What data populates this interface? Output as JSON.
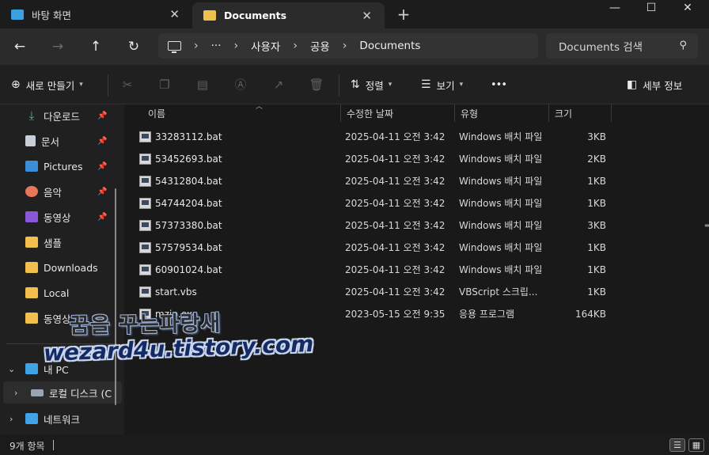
{
  "tabs": [
    {
      "label": "바탕 화면",
      "active": false,
      "icon": "desktop-folder-icon"
    },
    {
      "label": "Documents",
      "active": true,
      "icon": "folder-icon"
    }
  ],
  "window_controls": {
    "minimize": "—",
    "maximize": "☐",
    "close": "✕"
  },
  "nav": {
    "back": "back-arrow-icon",
    "forward": "forward-arrow-icon",
    "up": "up-arrow-icon",
    "refresh": "refresh-icon"
  },
  "address": {
    "segments": [
      "···",
      "사용자",
      "공용",
      "Documents"
    ]
  },
  "search": {
    "placeholder": "Documents 검색"
  },
  "commandbar": {
    "new_label": "새로 만들기",
    "sort_label": "정렬",
    "view_label": "보기",
    "more": "•••",
    "details_label": "세부 정보"
  },
  "sidebar": {
    "quick_access": [
      {
        "label": "다운로드",
        "icon": "download-icon",
        "pinned": true
      },
      {
        "label": "문서",
        "icon": "documents-icon",
        "pinned": true
      },
      {
        "label": "Pictures",
        "icon": "pictures-icon",
        "pinned": true
      },
      {
        "label": "음악",
        "icon": "music-icon",
        "pinned": true
      },
      {
        "label": "동영상",
        "icon": "video-icon",
        "pinned": true
      },
      {
        "label": "샘플",
        "icon": "folder-icon",
        "pinned": false
      },
      {
        "label": "Downloads",
        "icon": "folder-icon",
        "pinned": false
      },
      {
        "label": "Local",
        "icon": "folder-icon",
        "pinned": false
      },
      {
        "label": "동영상",
        "icon": "folder-icon",
        "pinned": false
      }
    ],
    "this_pc": "내 PC",
    "local_disk": "로컬 디스크 (C",
    "network": "네트워크"
  },
  "columns": {
    "name": "이름",
    "date": "수정한 날짜",
    "type": "유형",
    "size": "크기"
  },
  "files": [
    {
      "name": "33283112.bat",
      "date": "2025-04-11 오전 3:42",
      "type": "Windows 배치 파일",
      "size": "3KB"
    },
    {
      "name": "53452693.bat",
      "date": "2025-04-11 오전 3:42",
      "type": "Windows 배치 파일",
      "size": "2KB"
    },
    {
      "name": "54312804.bat",
      "date": "2025-04-11 오전 3:42",
      "type": "Windows 배치 파일",
      "size": "1KB"
    },
    {
      "name": "54744204.bat",
      "date": "2025-04-11 오전 3:42",
      "type": "Windows 배치 파일",
      "size": "1KB"
    },
    {
      "name": "57373380.bat",
      "date": "2025-04-11 오전 3:42",
      "type": "Windows 배치 파일",
      "size": "3KB"
    },
    {
      "name": "57579534.bat",
      "date": "2025-04-11 오전 3:42",
      "type": "Windows 배치 파일",
      "size": "1KB"
    },
    {
      "name": "60901024.bat",
      "date": "2025-04-11 오전 3:42",
      "type": "Windows 배치 파일",
      "size": "1KB"
    },
    {
      "name": "start.vbs",
      "date": "2025-04-11 오전 3:42",
      "type": "VBScript 스크립...",
      "size": "1KB"
    },
    {
      "name": "mzip.exe",
      "date": "2023-05-15 오전 9:35",
      "type": "응용 프로그램",
      "size": "164KB"
    }
  ],
  "watermark": {
    "line1": "꿈을 꾸는파랑새",
    "line2": "wezard4u.tistory.com"
  },
  "status": {
    "count": "9개 항목"
  },
  "colors": {
    "folder": "#f0c04a",
    "accent": "#4c9be8",
    "background": "#191919"
  }
}
